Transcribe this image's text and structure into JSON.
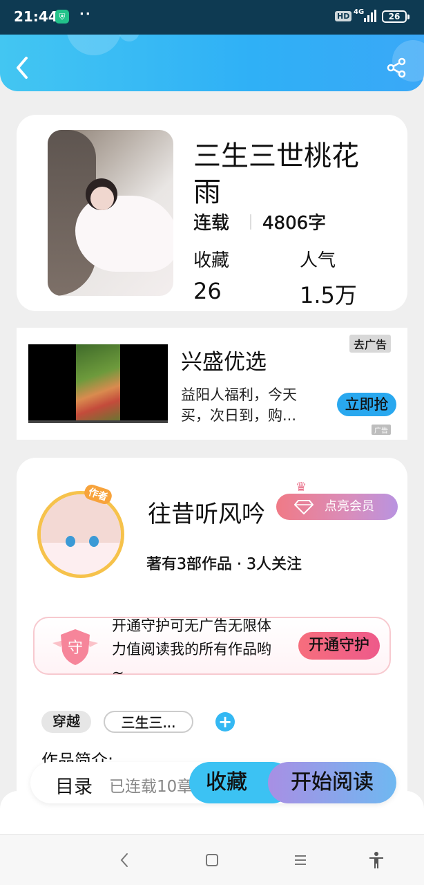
{
  "status_bar": {
    "time": "21:44",
    "hd": "HD",
    "network": "4G",
    "battery": "26"
  },
  "header": {
    "back_icon": "chevron-left-icon",
    "share_icon": "share-icon"
  },
  "book": {
    "title": "三生三世桃花雨",
    "status": "连载",
    "word_count": "4806字",
    "favorites_label": "收藏",
    "favorites_value": "26",
    "popularity_label": "人气",
    "popularity_value": "1.5万"
  },
  "ad": {
    "title": "兴盛优选",
    "description": "益阳人福利，今天买，次日到，购...",
    "remove_label": "去广告",
    "cta": "立即抢",
    "badge": "广告"
  },
  "author": {
    "badge": "作者",
    "name": "往昔听风吟",
    "vip_button": "点亮会员",
    "meta": "著有3部作品 · 3人关注",
    "guard_icon_label": "守",
    "guard_text": "开通守护可无广告无限体力值阅读我的所有作品哟~",
    "guard_button": "开通守护",
    "tags": [
      "穿越",
      "三生三..."
    ],
    "intro_label": "作品简介:"
  },
  "action_bar": {
    "toc": "目录",
    "serial": "已连载10章",
    "favorite": "收藏",
    "start_reading": "开始阅读"
  },
  "colors": {
    "accent_blue": "#2fb0f6",
    "vip_pink": "#f07a86",
    "guard_red": "#f66e7d"
  }
}
